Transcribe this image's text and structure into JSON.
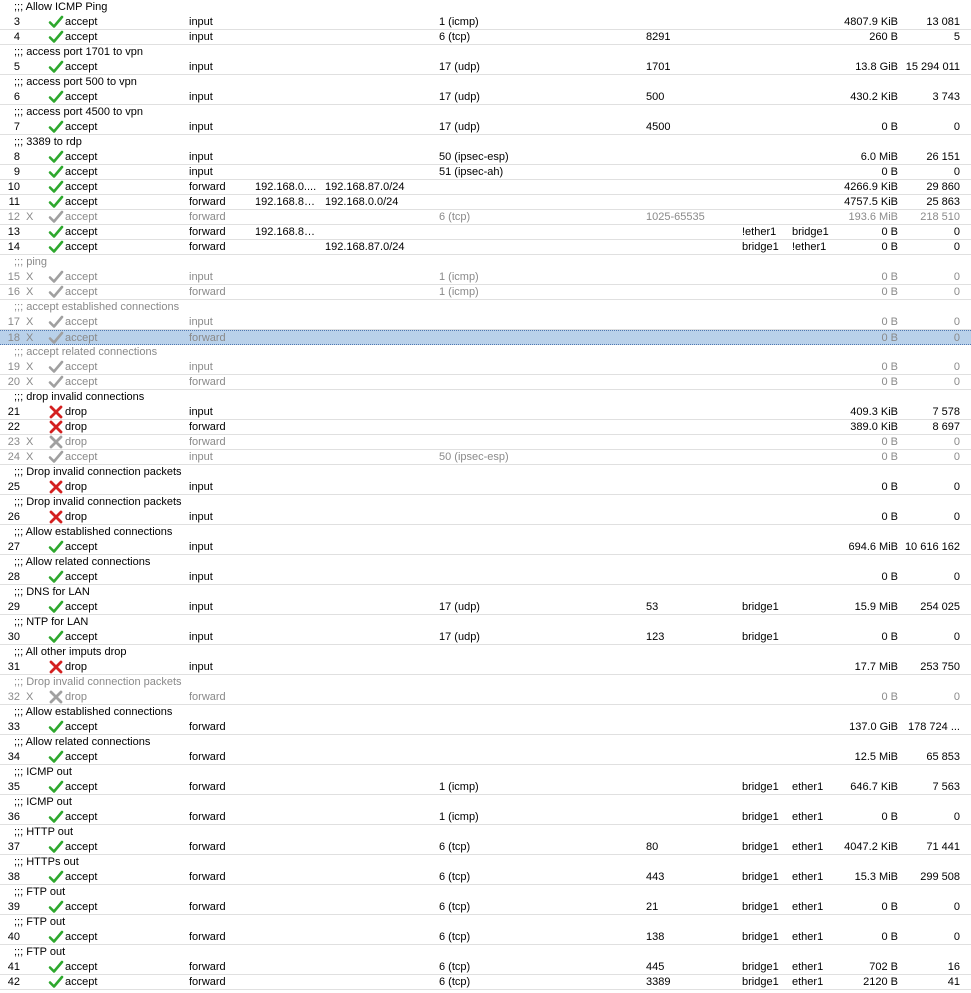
{
  "rules": [
    {
      "comment": ";;; Allow ICMP Ping",
      "id": "3",
      "disabled": false,
      "action": "accept",
      "chain": "input",
      "src": "",
      "dst": "",
      "proto": "1 (icmp)",
      "port": "",
      "in": "",
      "out": "",
      "bytes": "4807.9 KiB",
      "packets": "13 081"
    },
    {
      "comment": "",
      "id": "4",
      "disabled": false,
      "action": "accept",
      "chain": "input",
      "src": "",
      "dst": "",
      "proto": "6 (tcp)",
      "port": "8291",
      "in": "",
      "out": "",
      "bytes": "260 B",
      "packets": "5"
    },
    {
      "comment": ";;; access port 1701 to vpn",
      "id": "5",
      "disabled": false,
      "action": "accept",
      "chain": "input",
      "src": "",
      "dst": "",
      "proto": "17 (udp)",
      "port": "1701",
      "in": "",
      "out": "",
      "bytes": "13.8 GiB",
      "packets": "15 294 011"
    },
    {
      "comment": ";;; access port 500 to vpn",
      "id": "6",
      "disabled": false,
      "action": "accept",
      "chain": "input",
      "src": "",
      "dst": "",
      "proto": "17 (udp)",
      "port": "500",
      "in": "",
      "out": "",
      "bytes": "430.2 KiB",
      "packets": "3 743"
    },
    {
      "comment": ";;; access port 4500 to vpn",
      "id": "7",
      "disabled": false,
      "action": "accept",
      "chain": "input",
      "src": "",
      "dst": "",
      "proto": "17 (udp)",
      "port": "4500",
      "in": "",
      "out": "",
      "bytes": "0 B",
      "packets": "0"
    },
    {
      "comment": ";;; 3389 to rdp",
      "id": "8",
      "disabled": false,
      "action": "accept",
      "chain": "input",
      "src": "",
      "dst": "",
      "proto": "50 (ipsec-esp)",
      "port": "",
      "in": "",
      "out": "",
      "bytes": "6.0 MiB",
      "packets": "26 151"
    },
    {
      "comment": "",
      "id": "9",
      "disabled": false,
      "action": "accept",
      "chain": "input",
      "src": "",
      "dst": "",
      "proto": "51 (ipsec-ah)",
      "port": "",
      "in": "",
      "out": "",
      "bytes": "0 B",
      "packets": "0"
    },
    {
      "comment": "",
      "id": "10",
      "disabled": false,
      "action": "accept",
      "chain": "forward",
      "src": "192.168.0....",
      "dst": "192.168.87.0/24",
      "proto": "",
      "port": "",
      "in": "",
      "out": "",
      "bytes": "4266.9 KiB",
      "packets": "29 860"
    },
    {
      "comment": "",
      "id": "11",
      "disabled": false,
      "action": "accept",
      "chain": "forward",
      "src": "192.168.87....",
      "dst": "192.168.0.0/24",
      "proto": "",
      "port": "",
      "in": "",
      "out": "",
      "bytes": "4757.5 KiB",
      "packets": "25 863"
    },
    {
      "comment": "",
      "id": "12",
      "disabled": true,
      "action": "accept",
      "chain": "forward",
      "src": "",
      "dst": "",
      "proto": "6 (tcp)",
      "port": "1025-65535",
      "in": "",
      "out": "",
      "bytes": "193.6 MiB",
      "packets": "218 510"
    },
    {
      "comment": "",
      "id": "13",
      "disabled": false,
      "action": "accept",
      "chain": "forward",
      "src": "192.168.87....",
      "dst": "",
      "proto": "",
      "port": "",
      "in": "!ether1",
      "out": "bridge1",
      "bytes": "0 B",
      "packets": "0"
    },
    {
      "comment": "",
      "id": "14",
      "disabled": false,
      "action": "accept",
      "chain": "forward",
      "src": "",
      "dst": "192.168.87.0/24",
      "proto": "",
      "port": "",
      "in": "bridge1",
      "out": "!ether1",
      "bytes": "0 B",
      "packets": "0"
    },
    {
      "comment": ";;; ping",
      "commentDisabled": true,
      "id": "15",
      "disabled": true,
      "action": "accept",
      "chain": "input",
      "src": "",
      "dst": "",
      "proto": "1 (icmp)",
      "port": "",
      "in": "",
      "out": "",
      "bytes": "0 B",
      "packets": "0"
    },
    {
      "comment": "",
      "id": "16",
      "disabled": true,
      "action": "accept",
      "chain": "forward",
      "src": "",
      "dst": "",
      "proto": "1 (icmp)",
      "port": "",
      "in": "",
      "out": "",
      "bytes": "0 B",
      "packets": "0"
    },
    {
      "comment": ";;; accept established connections",
      "commentDisabled": true,
      "id": "17",
      "disabled": true,
      "action": "accept",
      "chain": "input",
      "src": "",
      "dst": "",
      "proto": "",
      "port": "",
      "in": "",
      "out": "",
      "bytes": "0 B",
      "packets": "0"
    },
    {
      "comment": "",
      "id": "18",
      "disabled": true,
      "selected": true,
      "action": "accept",
      "chain": "forward",
      "src": "",
      "dst": "",
      "proto": "",
      "port": "",
      "in": "",
      "out": "",
      "bytes": "0 B",
      "packets": "0"
    },
    {
      "comment": ";;; accept related connections",
      "commentDisabled": true,
      "id": "19",
      "disabled": true,
      "action": "accept",
      "chain": "input",
      "src": "",
      "dst": "",
      "proto": "",
      "port": "",
      "in": "",
      "out": "",
      "bytes": "0 B",
      "packets": "0"
    },
    {
      "comment": "",
      "id": "20",
      "disabled": true,
      "action": "accept",
      "chain": "forward",
      "src": "",
      "dst": "",
      "proto": "",
      "port": "",
      "in": "",
      "out": "",
      "bytes": "0 B",
      "packets": "0"
    },
    {
      "comment": ";;; drop invalid connections",
      "id": "21",
      "disabled": false,
      "action": "drop",
      "chain": "input",
      "src": "",
      "dst": "",
      "proto": "",
      "port": "",
      "in": "",
      "out": "",
      "bytes": "409.3 KiB",
      "packets": "7 578"
    },
    {
      "comment": "",
      "id": "22",
      "disabled": false,
      "action": "drop",
      "chain": "forward",
      "src": "",
      "dst": "",
      "proto": "",
      "port": "",
      "in": "",
      "out": "",
      "bytes": "389.0 KiB",
      "packets": "8 697"
    },
    {
      "comment": "",
      "id": "23",
      "disabled": true,
      "action": "drop",
      "chain": "forward",
      "src": "",
      "dst": "",
      "proto": "",
      "port": "",
      "in": "",
      "out": "",
      "bytes": "0 B",
      "packets": "0"
    },
    {
      "comment": "",
      "id": "24",
      "disabled": true,
      "action": "accept",
      "chain": "input",
      "src": "",
      "dst": "",
      "proto": "50 (ipsec-esp)",
      "port": "",
      "in": "",
      "out": "",
      "bytes": "0 B",
      "packets": "0"
    },
    {
      "comment": ";;; Drop invalid connection packets",
      "id": "25",
      "disabled": false,
      "action": "drop",
      "chain": "input",
      "src": "",
      "dst": "",
      "proto": "",
      "port": "",
      "in": "",
      "out": "",
      "bytes": "0 B",
      "packets": "0"
    },
    {
      "comment": ";;; Drop invalid connection packets",
      "id": "26",
      "disabled": false,
      "action": "drop",
      "chain": "input",
      "src": "",
      "dst": "",
      "proto": "",
      "port": "",
      "in": "",
      "out": "",
      "bytes": "0 B",
      "packets": "0"
    },
    {
      "comment": ";;; Allow established connections",
      "id": "27",
      "disabled": false,
      "action": "accept",
      "chain": "input",
      "src": "",
      "dst": "",
      "proto": "",
      "port": "",
      "in": "",
      "out": "",
      "bytes": "694.6 MiB",
      "packets": "10 616 162"
    },
    {
      "comment": ";;; Allow related connections",
      "id": "28",
      "disabled": false,
      "action": "accept",
      "chain": "input",
      "src": "",
      "dst": "",
      "proto": "",
      "port": "",
      "in": "",
      "out": "",
      "bytes": "0 B",
      "packets": "0"
    },
    {
      "comment": ";;; DNS for LAN",
      "id": "29",
      "disabled": false,
      "action": "accept",
      "chain": "input",
      "src": "",
      "dst": "",
      "proto": "17 (udp)",
      "port": "53",
      "in": "bridge1",
      "out": "",
      "bytes": "15.9 MiB",
      "packets": "254 025"
    },
    {
      "comment": ";;; NTP  for LAN",
      "id": "30",
      "disabled": false,
      "action": "accept",
      "chain": "input",
      "src": "",
      "dst": "",
      "proto": "17 (udp)",
      "port": "123",
      "in": "bridge1",
      "out": "",
      "bytes": "0 B",
      "packets": "0"
    },
    {
      "comment": ";;; All other imputs drop",
      "id": "31",
      "disabled": false,
      "action": "drop",
      "chain": "input",
      "src": "",
      "dst": "",
      "proto": "",
      "port": "",
      "in": "",
      "out": "",
      "bytes": "17.7 MiB",
      "packets": "253 750"
    },
    {
      "comment": ";;; Drop invalid connection packets",
      "commentDisabled": true,
      "id": "32",
      "disabled": true,
      "action": "drop",
      "chain": "forward",
      "src": "",
      "dst": "",
      "proto": "",
      "port": "",
      "in": "",
      "out": "",
      "bytes": "0 B",
      "packets": "0"
    },
    {
      "comment": ";;; Allow established connections",
      "id": "33",
      "disabled": false,
      "action": "accept",
      "chain": "forward",
      "src": "",
      "dst": "",
      "proto": "",
      "port": "",
      "in": "",
      "out": "",
      "bytes": "137.0 GiB",
      "packets": "178 724 ..."
    },
    {
      "comment": ";;; Allow related connections",
      "id": "34",
      "disabled": false,
      "action": "accept",
      "chain": "forward",
      "src": "",
      "dst": "",
      "proto": "",
      "port": "",
      "in": "",
      "out": "",
      "bytes": "12.5 MiB",
      "packets": "65 853"
    },
    {
      "comment": ";;; ICMP out",
      "id": "35",
      "disabled": false,
      "action": "accept",
      "chain": "forward",
      "src": "",
      "dst": "",
      "proto": "1 (icmp)",
      "port": "",
      "in": "bridge1",
      "out": "ether1",
      "bytes": "646.7 KiB",
      "packets": "7 563"
    },
    {
      "comment": ";;; ICMP out",
      "id": "36",
      "disabled": false,
      "action": "accept",
      "chain": "forward",
      "src": "",
      "dst": "",
      "proto": "1 (icmp)",
      "port": "",
      "in": "bridge1",
      "out": "ether1",
      "bytes": "0 B",
      "packets": "0"
    },
    {
      "comment": ";;; HTTP out",
      "id": "37",
      "disabled": false,
      "action": "accept",
      "chain": "forward",
      "src": "",
      "dst": "",
      "proto": "6 (tcp)",
      "port": "80",
      "in": "bridge1",
      "out": "ether1",
      "bytes": "4047.2 KiB",
      "packets": "71 441"
    },
    {
      "comment": ";;; HTTPs out",
      "id": "38",
      "disabled": false,
      "action": "accept",
      "chain": "forward",
      "src": "",
      "dst": "",
      "proto": "6 (tcp)",
      "port": "443",
      "in": "bridge1",
      "out": "ether1",
      "bytes": "15.3 MiB",
      "packets": "299 508"
    },
    {
      "comment": ";;; FTP out",
      "id": "39",
      "disabled": false,
      "action": "accept",
      "chain": "forward",
      "src": "",
      "dst": "",
      "proto": "6 (tcp)",
      "port": "21",
      "in": "bridge1",
      "out": "ether1",
      "bytes": "0 B",
      "packets": "0"
    },
    {
      "comment": ";;; FTP out",
      "id": "40",
      "disabled": false,
      "action": "accept",
      "chain": "forward",
      "src": "",
      "dst": "",
      "proto": "6 (tcp)",
      "port": "138",
      "in": "bridge1",
      "out": "ether1",
      "bytes": "0 B",
      "packets": "0"
    },
    {
      "comment": ";;; FTP out",
      "id": "41",
      "disabled": false,
      "action": "accept",
      "chain": "forward",
      "src": "",
      "dst": "",
      "proto": "6 (tcp)",
      "port": "445",
      "in": "bridge1",
      "out": "ether1",
      "bytes": "702 B",
      "packets": "16"
    },
    {
      "comment": "",
      "id": "42",
      "disabled": false,
      "action": "accept",
      "chain": "forward",
      "src": "",
      "dst": "",
      "proto": "6 (tcp)",
      "port": "3389",
      "in": "bridge1",
      "out": "ether1",
      "bytes": "2120 B",
      "packets": "41"
    }
  ],
  "disabled_flag": "X",
  "icons": {
    "accept": "checkmark-icon",
    "drop": "red-x-icon"
  },
  "colors": {
    "accept_green": "#2ea82e",
    "drop_red": "#d42020",
    "disabled_gray": "#8a8a8a",
    "selected_row": "#b9d1ea"
  }
}
